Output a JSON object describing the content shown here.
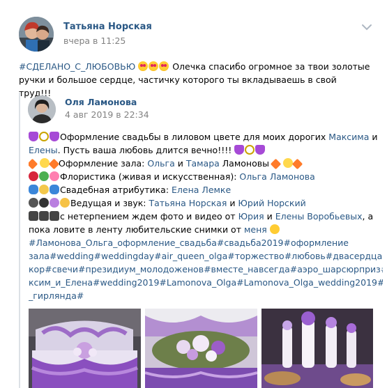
{
  "post": {
    "author": "Татьяна Норская",
    "time": "вчера в 11:25",
    "hashtag": "#СДЕЛАНО_С_ЛЮБОВЬЮ",
    "text_line1": "Олечка спасибо огромное за твои золотые",
    "text_line2": "ручки и большое сердце, частичку которого ты вкладываешь в свой труд!!!"
  },
  "repost": {
    "author": "Оля Ламонова",
    "time": "4 авг 2019 в 22:34",
    "line1_text": "Оформление свадьбы в лиловом цвете для моих дорогих ",
    "line1_link": "Максима",
    "line1_and": " и",
    "line2_link": "Елены",
    "line2_text": ". Пусть ваша любовь длится вечно!!!! ",
    "line3_text": "Оформление зала: ",
    "line3_link1": "Ольга",
    "line3_and": " и ",
    "line3_link2": "Тамара",
    "line3_tail": " Ламоновы ",
    "line4_text": "Флористика (живая и искусственная): ",
    "line4_link": "Ольга Ламонова",
    "line5_text": "Свадебная атрибутика: ",
    "line5_link": "Елена Лемке",
    "line6_text": "Ведущая и звук: ",
    "line6_link1": "Татьяна Норская",
    "line6_and": " и ",
    "line6_link2": "Юрий Норский",
    "line7_text": "с нетерпением ждем фото и видео от ",
    "line7_link1": "Юрия",
    "line7_and": " и ",
    "line7_link2": "Елены Воробьевых",
    "line7_tail": ", а",
    "line8_text": "пока ловите в ленту любительские снимки от ",
    "line8_link": "меня",
    "tags_line1": "#Ламонова_Ольга_оформление_свадьба#свадьба2019#оформление",
    "tags_line2": "зала#wedding#weddingday#air_queen_olga#торжество#любовь#двасердцаа#де",
    "tags_line3": "кор#свечи#президиум_молодоженов#вместе_навсегда#аэро_шарсюрприз#Ма",
    "tags_line4": "ксим_и_Елена#wedding2019#Lamonova_Olga#Lamonova_Olga_wedding2019#аэро",
    "tags_line5": "_гирлянда#"
  },
  "colors": {
    "link": "#2a5885",
    "muted": "#828282",
    "divider": "#dce1e6"
  },
  "icons": [
    "chevron-down-icon",
    "heart-eyes-emoji",
    "purple-heart-emoji",
    "ring-emoji",
    "sparkle-emoji",
    "rose-emoji",
    "butterfly-emoji",
    "microphone-emoji",
    "headphones-emoji",
    "camera-emoji",
    "wink-emoji"
  ]
}
